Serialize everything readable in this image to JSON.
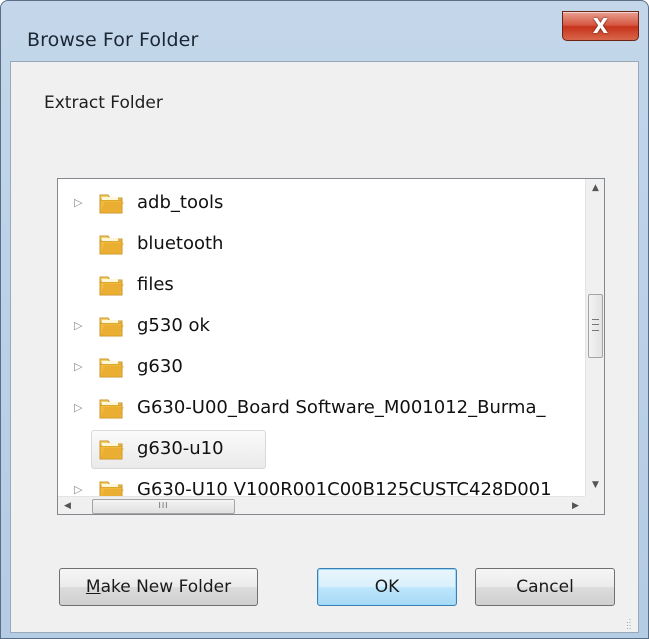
{
  "window": {
    "title": "Browse For Folder",
    "close_glyph": "X"
  },
  "dialog": {
    "description": "Extract Folder"
  },
  "tree": {
    "items": [
      {
        "label": "adb_tools",
        "expander": "▷"
      },
      {
        "label": "bluetooth",
        "expander": ""
      },
      {
        "label": "files",
        "expander": ""
      },
      {
        "label": "g530 ok",
        "expander": "▷"
      },
      {
        "label": "g630",
        "expander": "▷"
      },
      {
        "label": "G630-U00_Board Software_M001012_Burma_",
        "expander": "▷"
      },
      {
        "label": "g630-u10",
        "expander": "",
        "selected": true
      },
      {
        "label": "G630-U10 V100R001C00B125CUSTC428D001",
        "expander": "▷"
      }
    ],
    "scroll_glyphs": {
      "up": "▲",
      "down": "▼",
      "left": "◀",
      "right": "▶",
      "h_thumb_grip": "III"
    }
  },
  "buttons": {
    "make_new_folder": "Make New Folder",
    "make_new_folder_accel": "M",
    "make_new_folder_rest": "ake New Folder",
    "ok": "OK",
    "cancel": "Cancel"
  },
  "colors": {
    "title_bar": "#bcd2e8",
    "close_button": "#c6321a",
    "dialog_body": "#f0f0f0",
    "default_button": "#bee6fd",
    "folder": "#e8b03c"
  },
  "icons": {
    "folder": "folder-icon",
    "expander": "triangle-right-icon",
    "close": "close-icon"
  }
}
